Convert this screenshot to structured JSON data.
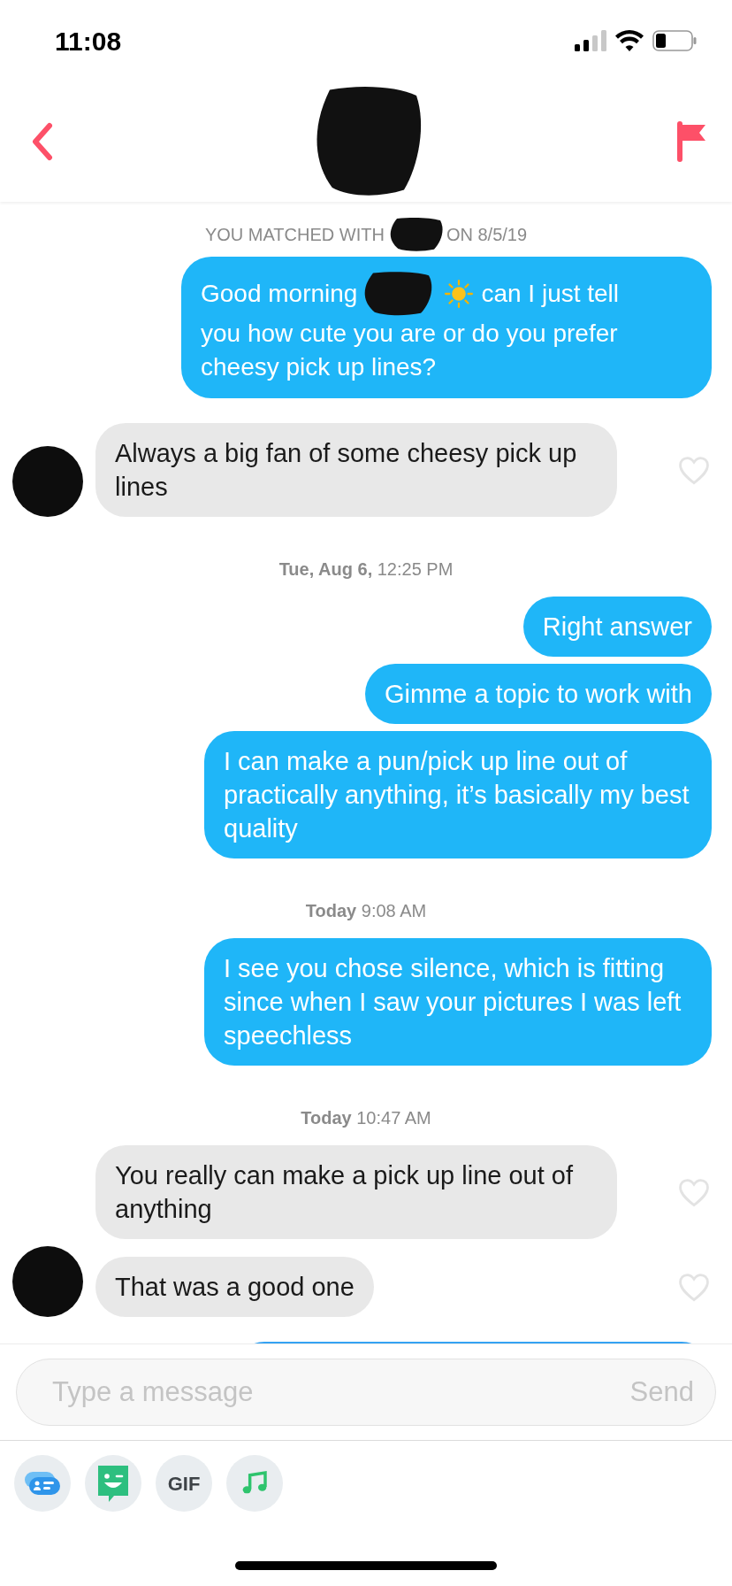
{
  "status_bar": {
    "time": "11:08"
  },
  "match_notice": {
    "before": "YOU MATCHED WITH",
    "after": "ON 8/5/19"
  },
  "messages": [
    {
      "kind": "outgoing_redacted",
      "text_before": "Good morning",
      "text_after": "can I just tell",
      "continuation": "you how cute you are or do you prefer cheesy pick up lines?"
    },
    {
      "kind": "incoming",
      "text": "Always a big fan of some cheesy pick up lines",
      "liked": false,
      "show_avatar": true
    },
    {
      "kind": "timestamp",
      "text": "**Tue, Aug 6,** 12:25 PM"
    },
    {
      "kind": "outgoing",
      "text": "Right answer"
    },
    {
      "kind": "outgoing",
      "text": "Gimme a topic to work with"
    },
    {
      "kind": "outgoing",
      "text": "I can make a pun/pick up line out of practically anything, it’s basically my best quality"
    },
    {
      "kind": "timestamp",
      "text": "**Today** 9:08 AM"
    },
    {
      "kind": "outgoing",
      "text": "I see you chose silence, which is fitting since when I saw your pictures I was left speechless"
    },
    {
      "kind": "timestamp",
      "text": "**Today** 10:47 AM"
    },
    {
      "kind": "incoming",
      "text": "You really can make a pick up line out of anything",
      "liked": false,
      "show_avatar": false
    },
    {
      "kind": "incoming",
      "text": "That was a good one",
      "liked": false,
      "show_avatar": true
    },
    {
      "kind": "partial"
    }
  ],
  "composer": {
    "placeholder": "Type a message",
    "send": "Send"
  },
  "tools": [
    {
      "kind": "cards"
    },
    {
      "kind": "bitmoji"
    },
    {
      "kind": "gif",
      "label": "GIF"
    },
    {
      "kind": "music"
    }
  ]
}
